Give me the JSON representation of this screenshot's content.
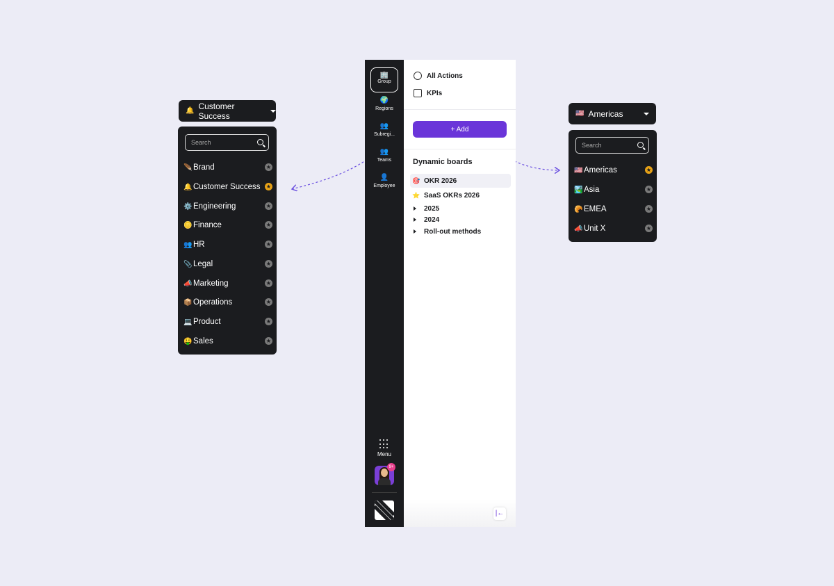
{
  "left_dropdown": {
    "selected_emoji": "🔔",
    "selected_label": "Customer Success",
    "search_placeholder": "Search",
    "items": [
      {
        "emoji": "🪶",
        "label": "Brand",
        "starred": false
      },
      {
        "emoji": "🔔",
        "label": "Customer Success",
        "starred": true
      },
      {
        "emoji": "⚙️",
        "label": "Engineering",
        "starred": false
      },
      {
        "emoji": "🪙",
        "label": "Finance",
        "starred": false
      },
      {
        "emoji": "👥",
        "label": "HR",
        "starred": false
      },
      {
        "emoji": "📎",
        "label": "Legal",
        "starred": false
      },
      {
        "emoji": "📣",
        "label": "Marketing",
        "starred": false
      },
      {
        "emoji": "📦",
        "label": "Operations",
        "starred": false
      },
      {
        "emoji": "💻",
        "label": "Product",
        "starred": false
      },
      {
        "emoji": "🤑",
        "label": "Sales",
        "starred": false
      }
    ]
  },
  "right_dropdown": {
    "selected_emoji": "🇺🇸",
    "selected_label": "Americas",
    "search_placeholder": "Search",
    "items": [
      {
        "emoji": "🇺🇸",
        "label": "Americas",
        "starred": true
      },
      {
        "emoji": "🏞️",
        "label": "Asia",
        "starred": false
      },
      {
        "emoji": "🥐",
        "label": "EMEA",
        "starred": false
      },
      {
        "emoji": "📣",
        "label": "Unit X",
        "starred": false
      }
    ]
  },
  "rail": {
    "items": [
      {
        "icon": "🏢",
        "label": "Group"
      },
      {
        "icon": "🌍",
        "label": "Regions"
      },
      {
        "icon": "👥",
        "label": "Subregi..."
      },
      {
        "icon": "👥",
        "label": "Teams"
      },
      {
        "icon": "👤",
        "label": "Employee"
      }
    ],
    "menu_label": "Menu",
    "badge": "9+"
  },
  "main": {
    "nav": [
      {
        "icon": "check-circle-icon",
        "label": "All Actions"
      },
      {
        "icon": "kpi-grid-icon",
        "label": "KPIs"
      }
    ],
    "add_label": "+ Add",
    "section_title": "Dynamic boards",
    "boards": [
      {
        "emoji": "🎯",
        "label": "OKR 2026",
        "selected": true,
        "type": "item"
      },
      {
        "emoji": "⭐",
        "label": "SaaS OKRs 2026",
        "selected": false,
        "type": "item"
      },
      {
        "label": "2025",
        "type": "folder"
      },
      {
        "label": "2024",
        "type": "folder"
      },
      {
        "label": "Roll-out methods",
        "type": "folder"
      }
    ],
    "collapse_icon": "|←"
  },
  "colors": {
    "background": "#ececf6",
    "dark": "#1b1c1f",
    "accent": "#6a35d9",
    "star_active": "#e8a317",
    "connector": "#6a4fe0"
  }
}
